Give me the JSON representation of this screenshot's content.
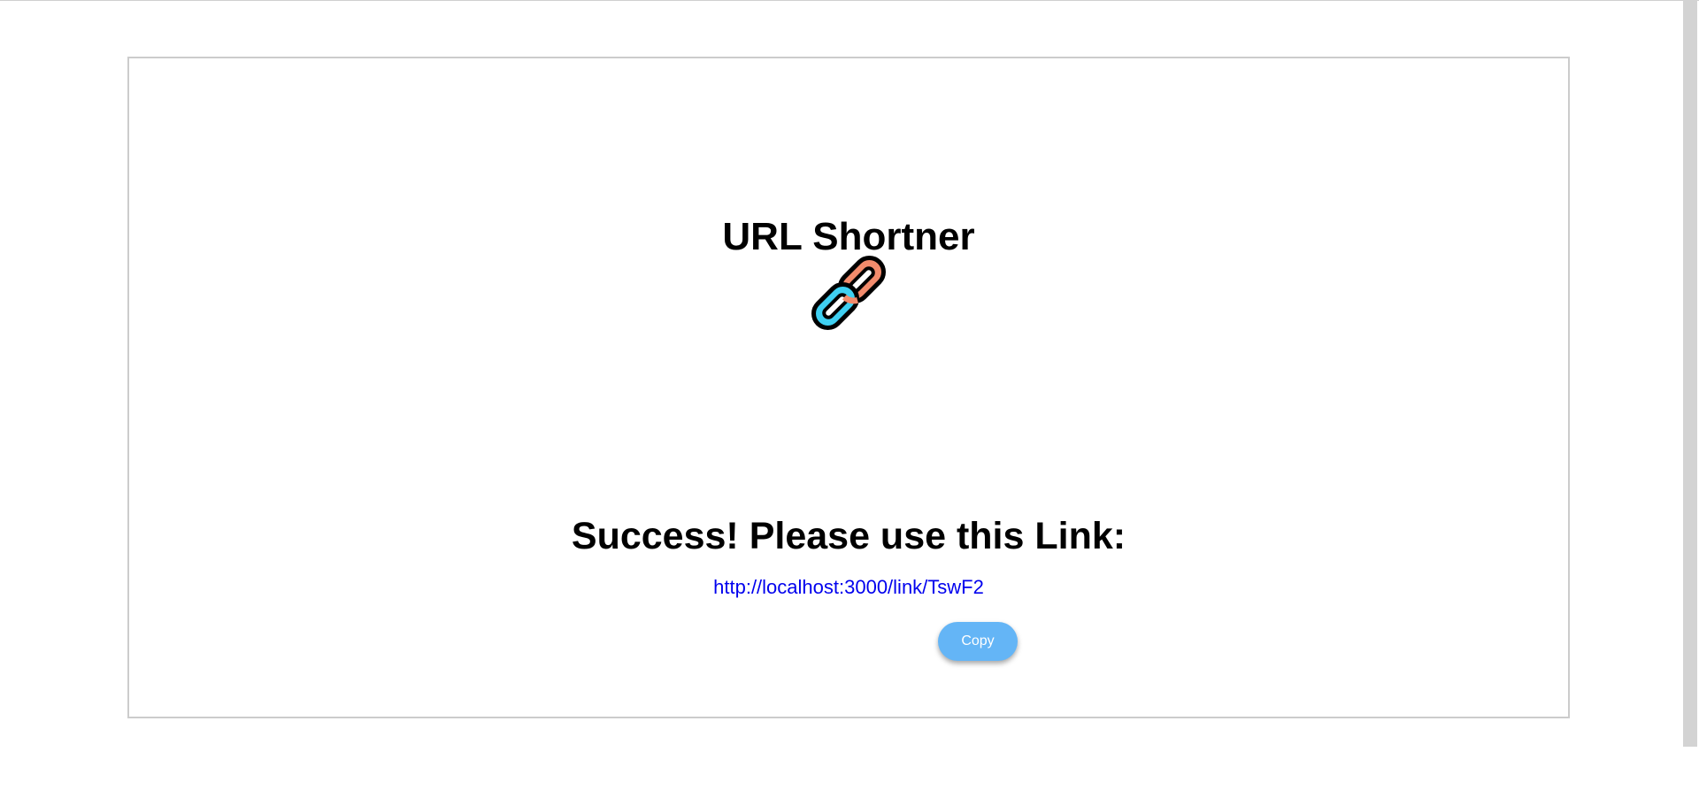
{
  "header": {
    "title": "URL Shortner",
    "logo_icon": "chain-link-icon"
  },
  "result": {
    "message": "Success! Please use this Link:",
    "short_url": "http://localhost:3000/link/TswF2",
    "copy_label": "Copy"
  },
  "colors": {
    "link_orange": "#f28b6c",
    "link_blue": "#3fd0f2",
    "button_bg": "#64b5f6",
    "link_text": "#0000ee"
  }
}
